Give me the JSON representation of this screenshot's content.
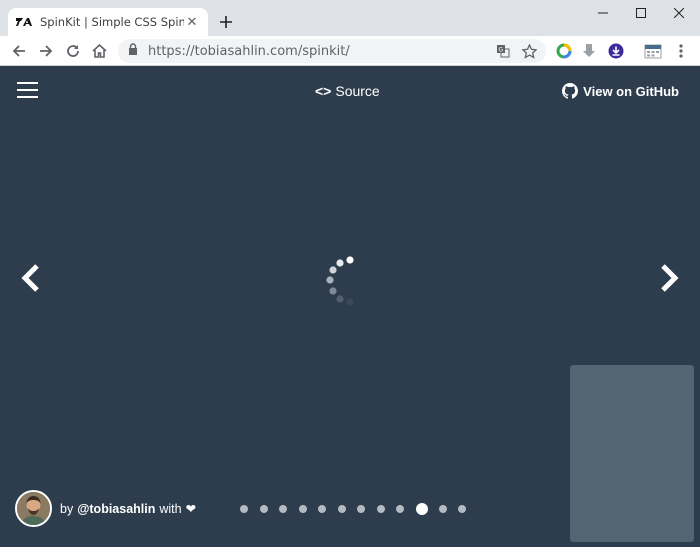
{
  "browser": {
    "tab_title": "SpinKit | Simple CSS Spinners",
    "url_host": "https://tobiasahlin.com",
    "url_path": "/spinkit/"
  },
  "header": {
    "source_label": "Source",
    "github_label": "View on GitHub"
  },
  "footer": {
    "by_label": "by",
    "author": "@tobiasahlin",
    "with_label": "with",
    "heart": "❤",
    "dots_total": 12,
    "active_dot": 10
  },
  "colors": {
    "page_bg": "#2e3d4e",
    "panel_bg": "#566574",
    "dot_inactive": "#b3bac2",
    "dot_active": "#ffffff"
  }
}
